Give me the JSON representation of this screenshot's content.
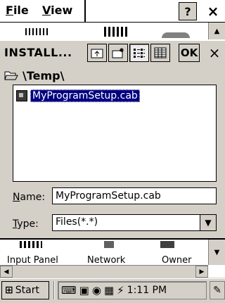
{
  "menubar": {
    "file_label": "File",
    "file_accel": "F",
    "file_rest": "ile",
    "view_accel": "V",
    "view_rest": "iew",
    "help_label": "?",
    "close_label": "×"
  },
  "dialog": {
    "title": "INSTALL...",
    "ok_label": "OK",
    "close_label": "×",
    "path": "\\Temp\\",
    "files": [
      {
        "name": "MyProgramSetup.cab",
        "selected": true
      }
    ],
    "name_label_accel": "N",
    "name_label_rest": "ame:",
    "name_value": "MyProgramSetup.cab",
    "type_label_accel": "T",
    "type_label_rest": "ype:",
    "type_value": "Files(*.*)"
  },
  "background": {
    "control_panel_items": [
      "Input Panel",
      "Network",
      "Owner"
    ]
  },
  "taskbar": {
    "start_label": "Start",
    "time": "1:11 PM"
  },
  "colors": {
    "selection": "#000080",
    "face": "#d4d0c8"
  },
  "icons": {
    "up_folder": "up-folder-icon",
    "new_folder": "new-folder-icon",
    "list_view": "list-view-icon",
    "details_view": "details-view-icon",
    "open_folder": "open-folder-icon",
    "file": "cab-file-icon"
  }
}
